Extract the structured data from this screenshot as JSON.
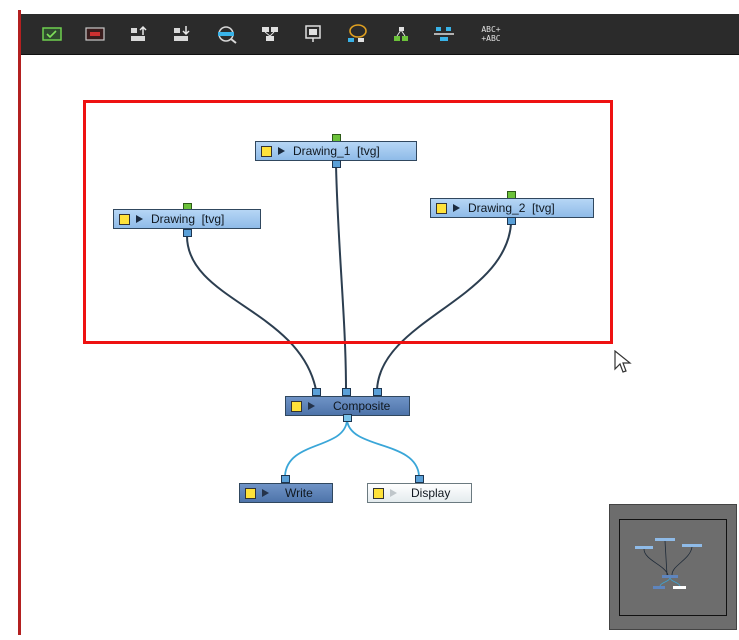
{
  "toolbar": {
    "tools": [
      {
        "name": "enable-icon"
      },
      {
        "name": "disable-icon"
      },
      {
        "name": "move-up-icon"
      },
      {
        "name": "move-down-icon"
      },
      {
        "name": "zoom-icon"
      },
      {
        "name": "group-icon"
      },
      {
        "name": "display-icon"
      },
      {
        "name": "lasso-icon"
      },
      {
        "name": "connect-icon"
      },
      {
        "name": "align-icon"
      },
      {
        "name": "rename-icon"
      }
    ],
    "rename_label": "ABC+\n+ABC"
  },
  "nodes": {
    "drawing_1": {
      "label": "Drawing_1  [tvg]"
    },
    "drawing": {
      "label": "Drawing  [tvg]"
    },
    "drawing_2": {
      "label": "Drawing_2  [tvg]"
    },
    "composite": {
      "label": "Composite"
    },
    "write": {
      "label": "Write"
    },
    "display": {
      "label": "Display"
    }
  },
  "colors": {
    "selection": "#ee1111",
    "toolbar_bg": "#2b2b2b",
    "node_light": "#a9cdf2",
    "node_dark": "#5f85bd",
    "wire_dark": "#2c3e50",
    "wire_light": "#3aa6d8"
  }
}
